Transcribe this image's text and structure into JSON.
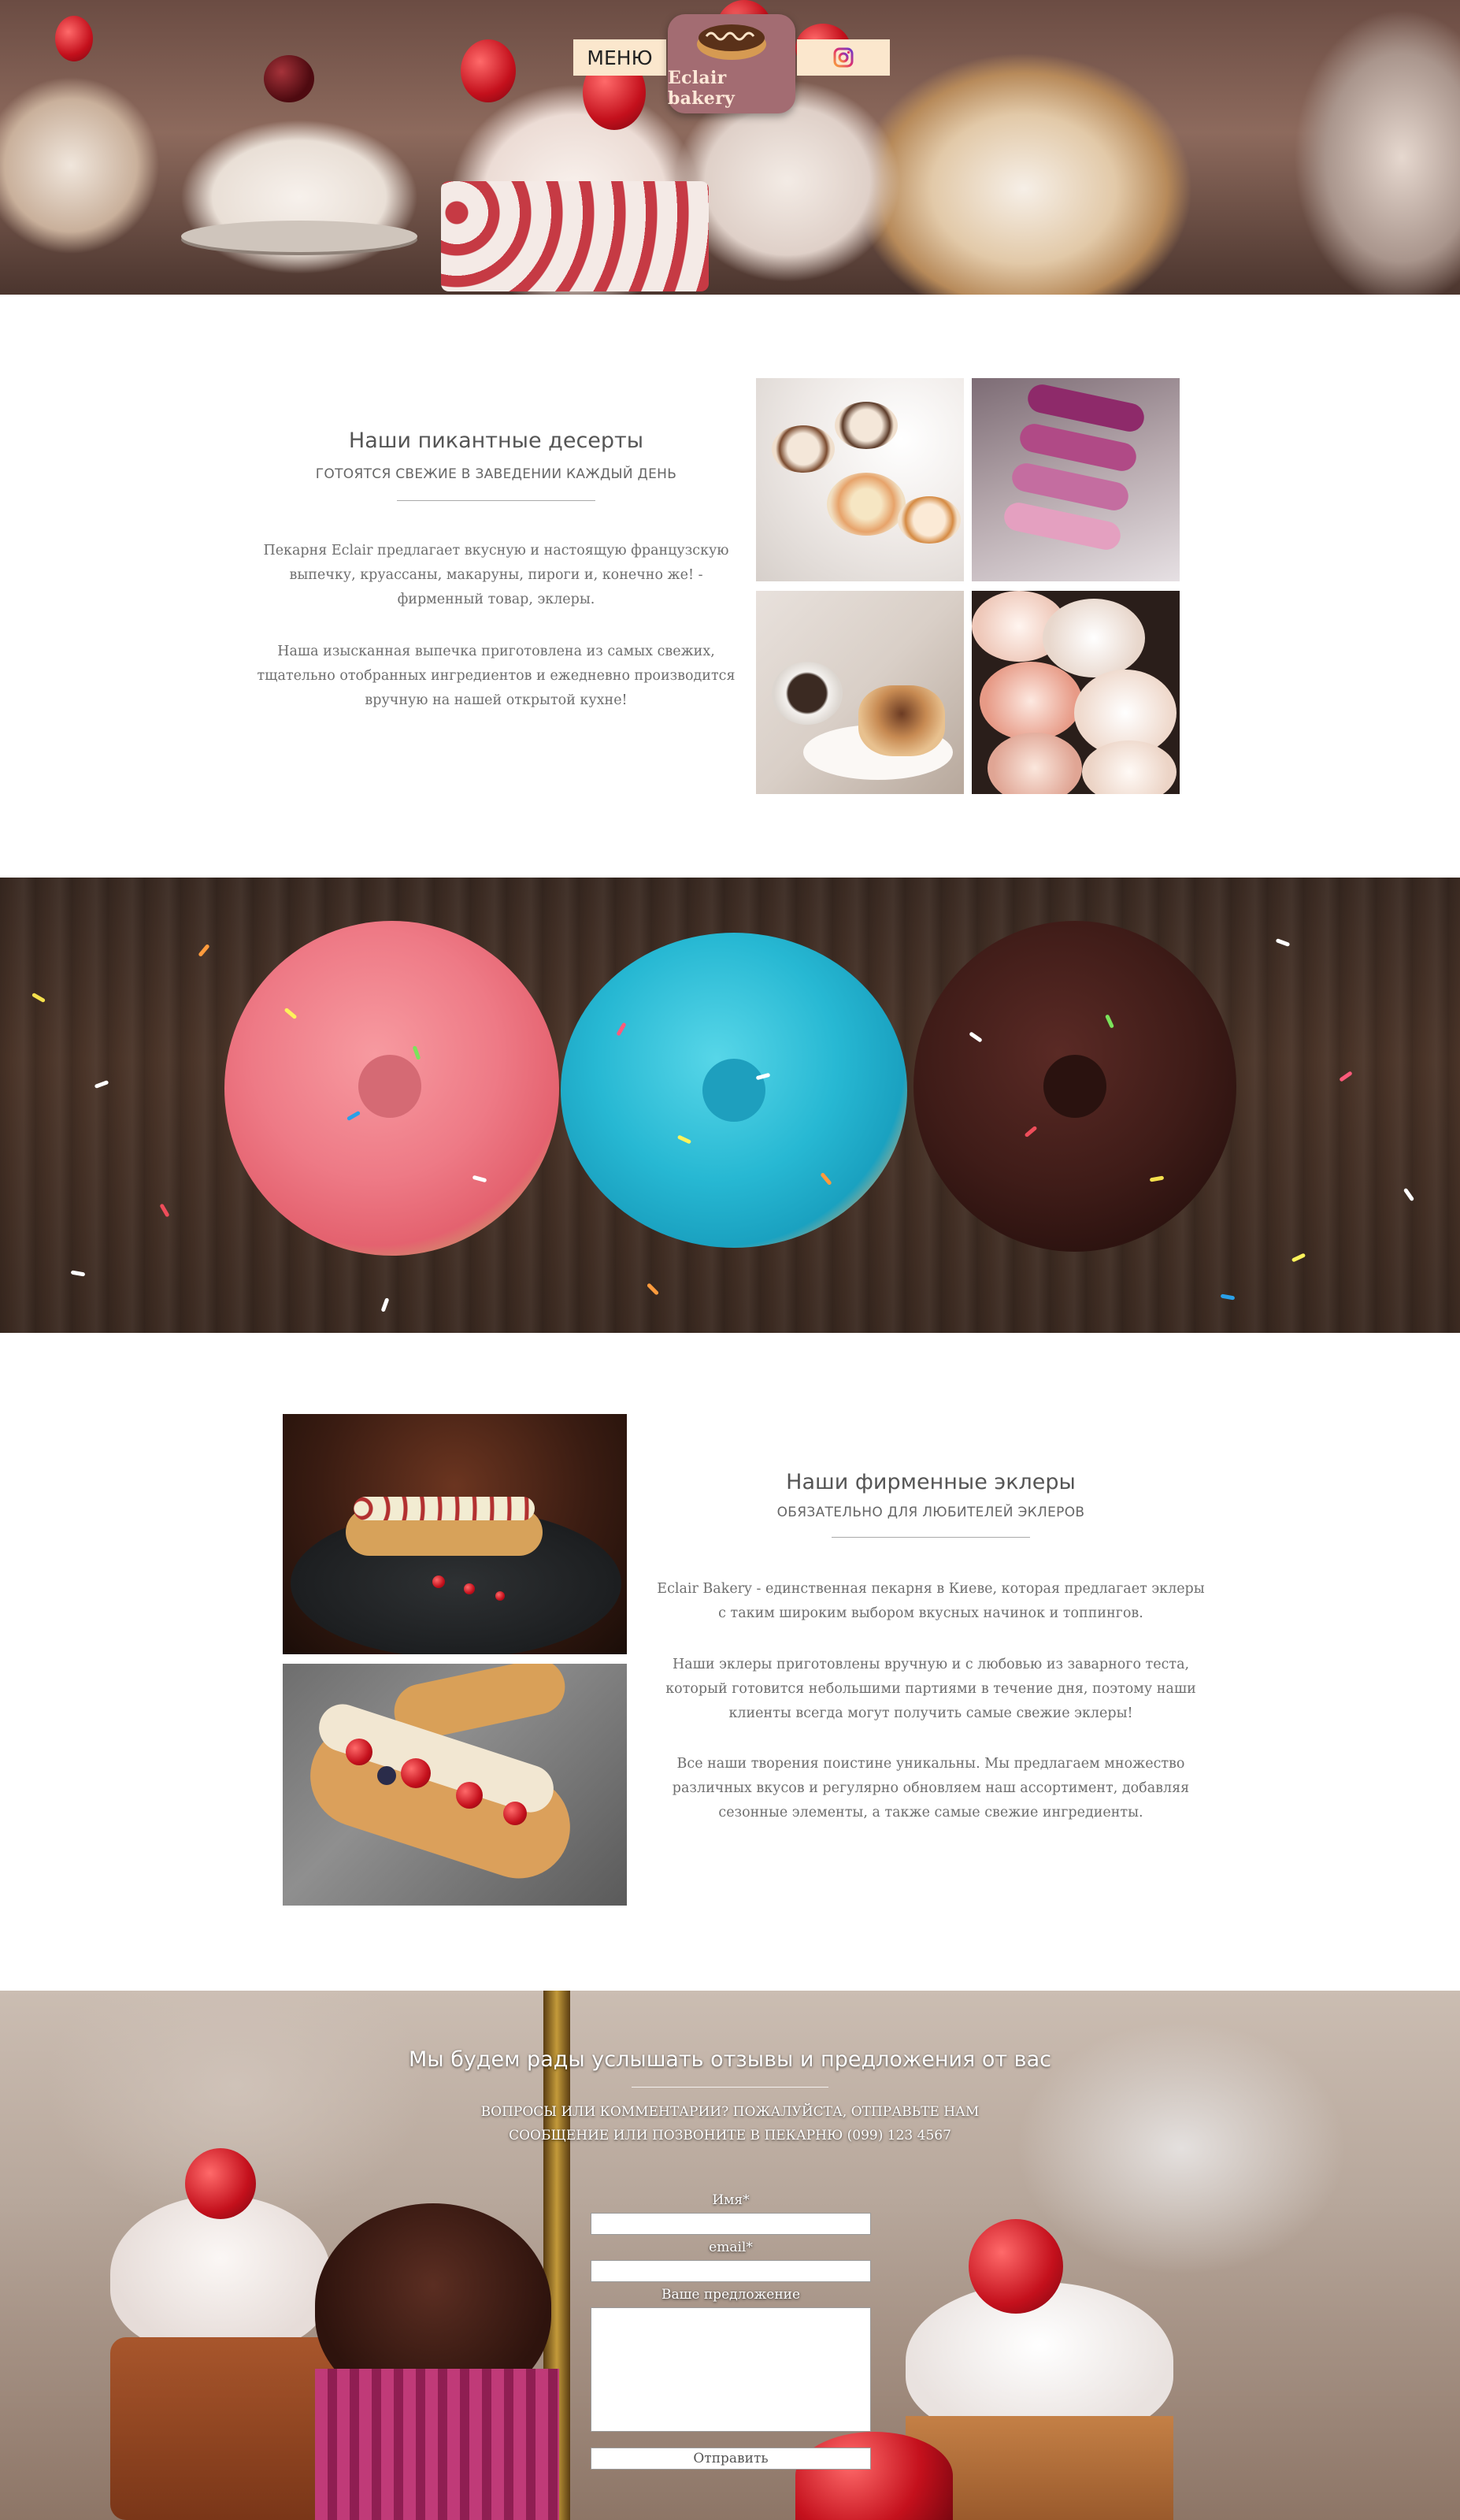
{
  "header": {
    "menu_label": "МЕНЮ",
    "logo_text": "Eclair bakery",
    "social_icon": "instagram-icon",
    "social_color": "#e1306c"
  },
  "desserts": {
    "title": "Наши пикантные десерты",
    "subtitle": "ГОТОЯТСЯ СВЕЖИЕ В ЗАВЕДЕНИИ КАЖДЫЙ ДЕНЬ",
    "paragraphs": [
      "Пекарня Eclair предлагает вкусную и настоящую французскую выпечку, круассаны, макаруны, пироги и, конечно же! - фирменный товар, эклеры.",
      "Наша изысканная выпечка приготовлена из самых свежих, тщательно отобранных ингредиентов и ежедневно производится вручную на нашей открытой кухне!"
    ]
  },
  "eclairs": {
    "title": "Наши фирменные эклеры",
    "subtitle": "ОБЯЗАТЕЛЬНО ДЛЯ ЛЮБИТЕЛЕЙ ЭКЛЕРОВ",
    "paragraphs": [
      "Eclair Bakery - единственная пекарня в Киеве, которая предлагает эклеры с таким широким выбором вкусных начинок и топпингов.",
      "Наши эклеры приготовлены вручную и с любовью из заварного теста, который готовится небольшими партиями в течение дня, поэтому наши клиенты всегда могут получить самые свежие эклеры!",
      "Все наши творения поистине уникальны. Мы предлагаем множество различных вкусов и регулярно обновляем наш ассортимент, добавляя сезонные элементы, а также самые свежие ингредиенты."
    ]
  },
  "contact": {
    "title": "Мы будем рады услышать отзывы и предложения от вас",
    "subtitle_line1": "ВОПРОСЫ ИЛИ КОММЕНТАРИИ? ПОЖАЛУЙСТА, ОТПРАВЬТЕ НАМ",
    "subtitle_line2": "СООБЩЕНИЕ ИЛИ ПОЗВОНИТЕ В ПЕКАРНЮ (099) 123 4567",
    "name_label": "Имя*",
    "email_label": "email*",
    "message_label": "Ваше предложение",
    "name_value": "",
    "email_value": "",
    "message_value": "",
    "submit_label": "Отправить"
  }
}
